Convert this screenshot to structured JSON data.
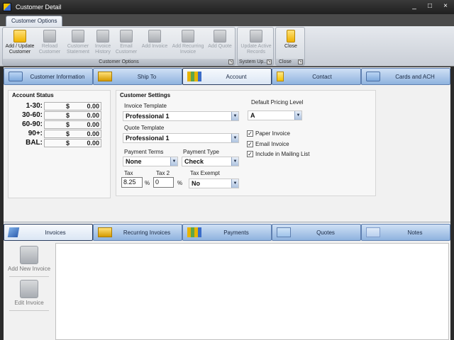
{
  "window": {
    "title": "Customer Detail",
    "minimize": "_",
    "maximize": "□",
    "close": "×"
  },
  "ribbon": {
    "tab": "Customer Options",
    "groups": [
      {
        "label": "Customer Options",
        "buttons": [
          {
            "label1": "Add / Update",
            "label2": "Customer",
            "icon": "folder-icon",
            "enabled": true
          },
          {
            "label1": "Reload",
            "label2": "Customer",
            "icon": "reload-icon",
            "enabled": false
          },
          {
            "label1": "Customer",
            "label2": "Statement",
            "icon": "statement-icon",
            "enabled": false
          },
          {
            "label1": "Invoice",
            "label2": "History",
            "icon": "history-icon",
            "enabled": false
          },
          {
            "label1": "Email",
            "label2": "Customer",
            "icon": "email-icon",
            "enabled": false
          },
          {
            "label1": "Add Invoice",
            "label2": "",
            "icon": "add-invoice-icon",
            "enabled": false
          },
          {
            "label1": "Add Recurring",
            "label2": "Invoice",
            "icon": "add-recurring-icon",
            "enabled": false
          },
          {
            "label1": "Add Quote",
            "label2": "",
            "icon": "add-quote-icon",
            "enabled": false
          }
        ]
      },
      {
        "label": "System Up...",
        "buttons": [
          {
            "label1": "Update Active",
            "label2": "Records",
            "icon": "update-icon",
            "enabled": false
          }
        ]
      },
      {
        "label": "Close",
        "buttons": [
          {
            "label1": "Close",
            "label2": "",
            "icon": "close-door-icon",
            "enabled": true
          }
        ]
      }
    ]
  },
  "top_tabs": [
    {
      "label": "Customer Information",
      "icon": "card-icon",
      "active": false
    },
    {
      "label": "Ship To",
      "icon": "box-icon",
      "active": false
    },
    {
      "label": "Account",
      "icon": "chart-icon",
      "active": true
    },
    {
      "label": "Contact",
      "icon": "phone-icon",
      "active": false
    },
    {
      "label": "Cards and ACH",
      "icon": "credit-card-icon",
      "active": false
    }
  ],
  "account_status": {
    "title": "Account Status",
    "rows": [
      {
        "label": "1-30:",
        "currency": "$",
        "amount": "0.00"
      },
      {
        "label": "30-60:",
        "currency": "$",
        "amount": "0.00"
      },
      {
        "label": "60-90:",
        "currency": "$",
        "amount": "0.00"
      },
      {
        "label": "90+:",
        "currency": "$",
        "amount": "0.00"
      },
      {
        "label": "BAL:",
        "currency": "$",
        "amount": "0.00"
      }
    ]
  },
  "settings": {
    "title": "Customer Settings",
    "invoice_template_label": "Invoice Template",
    "invoice_template_value": "Professional 1",
    "quote_template_label": "Quote Template",
    "quote_template_value": "Professional 1",
    "payment_terms_label": "Payment Terms",
    "payment_terms_value": "None",
    "payment_type_label": "Payment Type",
    "payment_type_value": "Check",
    "tax_label": "Tax",
    "tax_value": "8.25",
    "tax_pct": "%",
    "tax2_label": "Tax 2",
    "tax2_value": "0",
    "tax2_pct": "%",
    "tax_exempt_label": "Tax Exempt",
    "tax_exempt_value": "No",
    "pricing_level_label": "Default Pricing Level",
    "pricing_level_value": "A",
    "checkboxes": [
      {
        "label": "Paper Invoice",
        "checked": true
      },
      {
        "label": "Email Invoice",
        "checked": true
      },
      {
        "label": "Include in Mailing List",
        "checked": true
      }
    ],
    "check_mark": "✓",
    "arrow": "▼"
  },
  "bottom_tabs": [
    {
      "label": "Invoices",
      "icon": "pen-icon",
      "active": true
    },
    {
      "label": "Recurring Invoices",
      "icon": "box-icon",
      "active": false
    },
    {
      "label": "Payments",
      "icon": "chart-icon",
      "active": false
    },
    {
      "label": "Quotes",
      "icon": "check-icon",
      "active": false
    },
    {
      "label": "Notes",
      "icon": "note-icon",
      "active": false
    }
  ],
  "side_actions": [
    {
      "label": "Add New Invoice",
      "icon": "add-invoice-icon"
    },
    {
      "label": "Edit Invoice",
      "icon": "edit-invoice-icon"
    }
  ]
}
